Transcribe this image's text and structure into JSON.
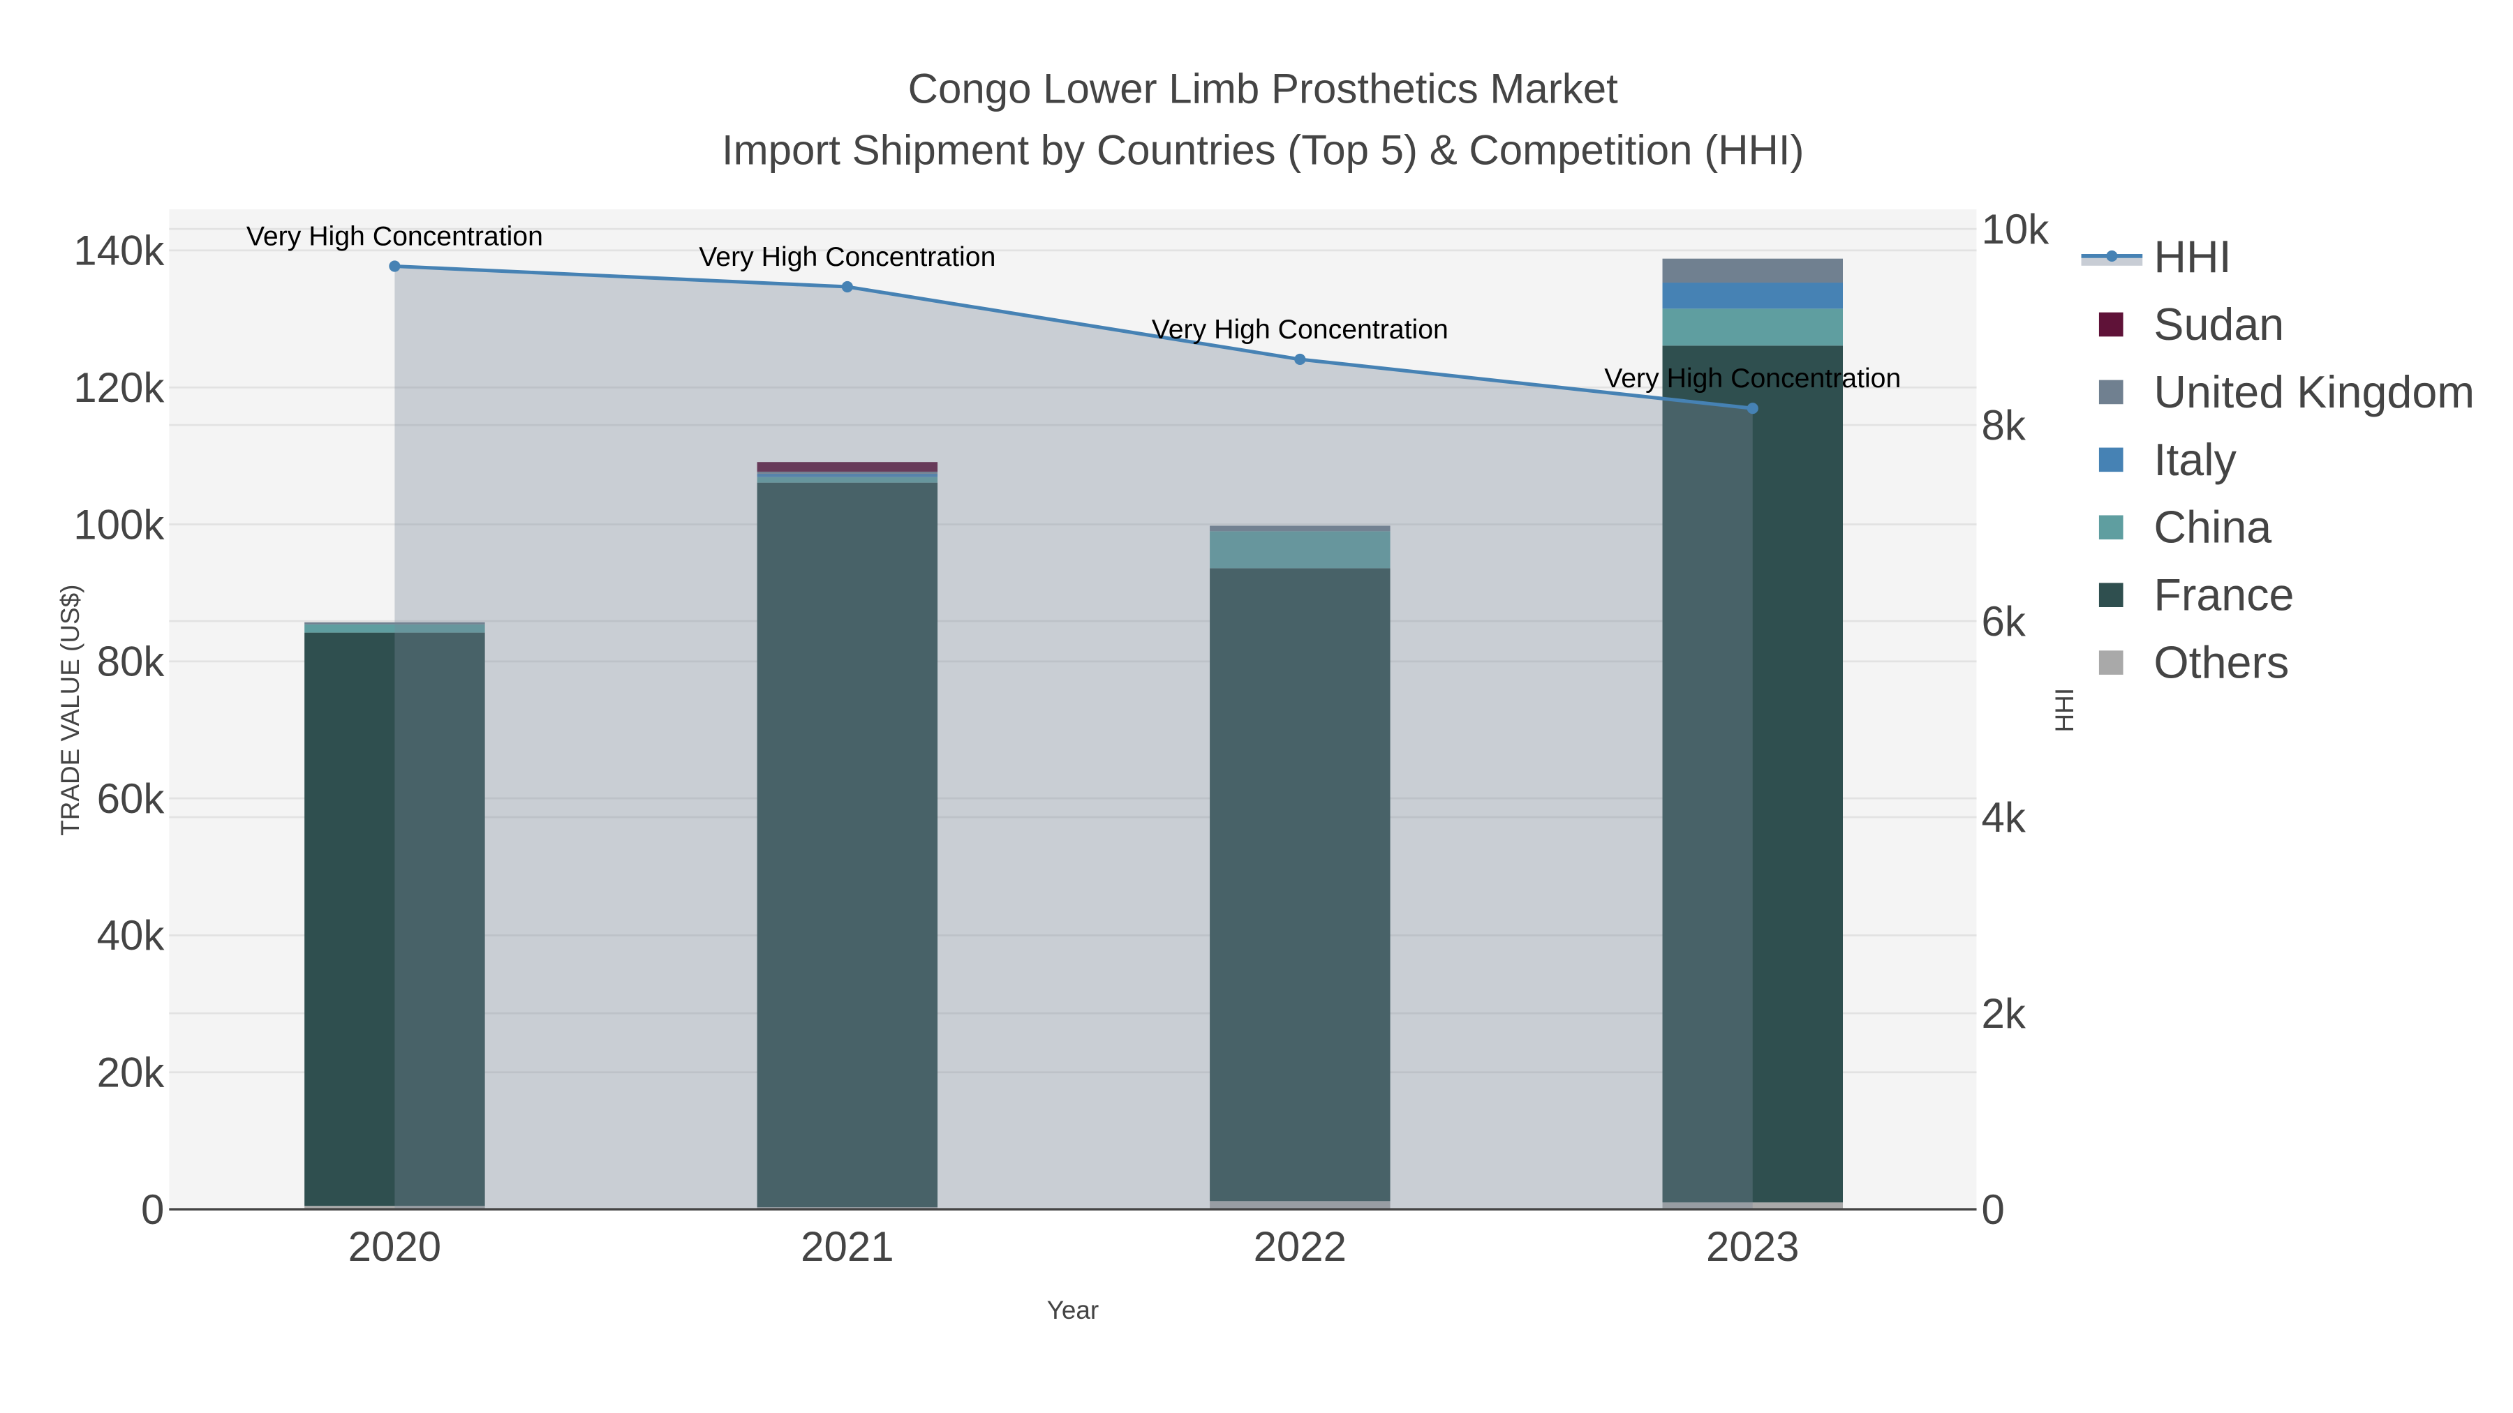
{
  "chart_data": {
    "type": "bar",
    "title": "Congo Lower Limb Prosthetics Market",
    "subtitle": "Import Shipment by Countries (Top 5) & Competition (HHI)",
    "xlabel": "Year",
    "ylabel": "TRADE VALUE (US$)",
    "y2label": "HHI",
    "categories": [
      "2020",
      "2021",
      "2022",
      "2023"
    ],
    "ylim": [
      0,
      146000
    ],
    "y2lim": [
      0,
      10200
    ],
    "yticks": [
      0,
      20000,
      40000,
      60000,
      80000,
      100000,
      120000,
      140000
    ],
    "ytick_labels": [
      "0",
      "20k",
      "40k",
      "60k",
      "80k",
      "100k",
      "120k",
      "140k"
    ],
    "y2ticks": [
      0,
      2000,
      4000,
      6000,
      8000,
      10000
    ],
    "y2tick_labels": [
      "0",
      "2k",
      "4k",
      "6k",
      "8k",
      "10k"
    ],
    "barmode": "stack",
    "grid": true,
    "legend_position": "right",
    "series": [
      {
        "name": "Others",
        "color": "#a9a9a9",
        "values": [
          500,
          300,
          1200,
          1000
        ]
      },
      {
        "name": "France",
        "color": "#2f4f4f",
        "values": [
          83700,
          105800,
          92400,
          125100
        ]
      },
      {
        "name": "China",
        "color": "#5f9ea0",
        "values": [
          1200,
          800,
          5400,
          5400
        ]
      },
      {
        "name": "Italy",
        "color": "#4682b4",
        "values": [
          0,
          500,
          0,
          3800
        ]
      },
      {
        "name": "United Kingdom",
        "color": "#708090",
        "values": [
          300,
          300,
          800,
          3500
        ]
      },
      {
        "name": "Sudan",
        "color": "#5f1238",
        "values": [
          0,
          1400,
          0,
          0
        ]
      }
    ],
    "line": {
      "name": "HHI",
      "color": "#4682b4",
      "fill": "rgba(119,136,153,0.35)",
      "values": [
        9620,
        9410,
        8670,
        8170
      ],
      "annotations": [
        "Very High Concentration",
        "Very High Concentration",
        "Very High Concentration",
        "Very High Concentration"
      ]
    },
    "legend_order": [
      "HHI",
      "Sudan",
      "United Kingdom",
      "Italy",
      "China",
      "France",
      "Others"
    ]
  }
}
